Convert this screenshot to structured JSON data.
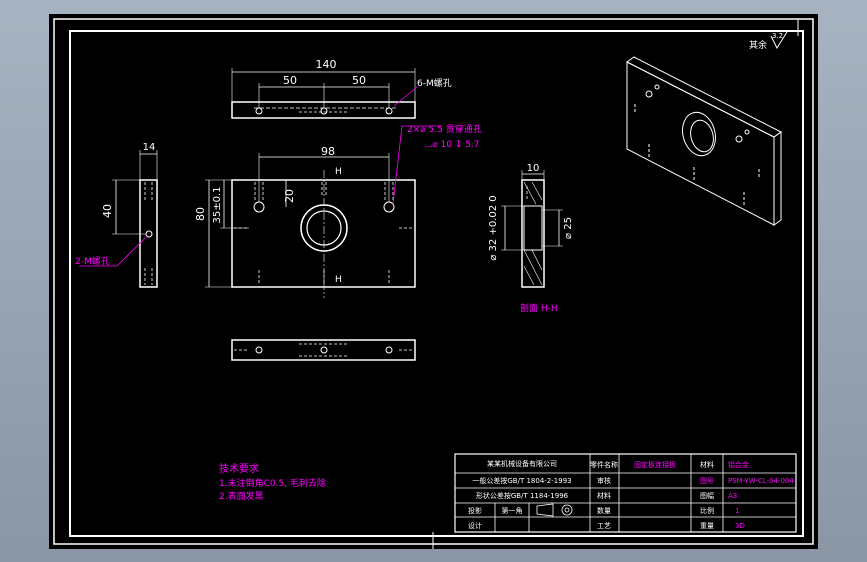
{
  "colors": {
    "background": "#000000",
    "outline": "#ffffff",
    "dimension": "#ffffff",
    "annotation": "#ff00ff",
    "hole": "#ffffff"
  },
  "dimensions": {
    "top_overall": "140",
    "top_left": "50",
    "top_right": "50",
    "top_threads": "6-M螺孔",
    "front_pitch": "98",
    "front_hole_offset": "20",
    "front_height": "80",
    "front_hole_height": "35±0.1",
    "front_counterbore": "2×⌀ 5.5 贯穿通孔",
    "front_counterbore_sub": "⌴⌀ 10 ↧ 5.7",
    "side_width": "14",
    "side_hole": "40",
    "side_threads": "2-M螺孔",
    "section_width": "10",
    "section_bore": "⌀ 32 +0.02 0",
    "section_inner": "⌀ 25",
    "section_name": "剖面 H-H",
    "section_mark_top": "H",
    "section_mark_bottom": "H"
  },
  "roughness": {
    "label": "其余",
    "value": "3.2"
  },
  "notes": {
    "heading": "技术要求",
    "line1": "1.未注倒角C0.5, 毛刺去除",
    "line2": "2.表面发黑"
  },
  "title_block": {
    "company": "某某机械设备有限公司",
    "tol_line1": "一般公差按GB/T 1804-2-1993",
    "tol_line2": "形状公差按GB/T 1184-1996",
    "projection": "投影",
    "sheet": "第一角",
    "design": "设计",
    "review": "审核",
    "process": "工艺",
    "part_name_label": "零件名称",
    "part_name": "固定板连接板",
    "material_label": "材料",
    "material": "铝合金",
    "drawing_no_label": "图号",
    "drawing_no": "PSM-YW-CL-04-004",
    "size_label": "图幅",
    "size": "A3",
    "qty_label": "数量",
    "qty": "1",
    "scale_label": "比例",
    "scale": "1:1",
    "weight_label": "重量",
    "weight": "3D"
  }
}
